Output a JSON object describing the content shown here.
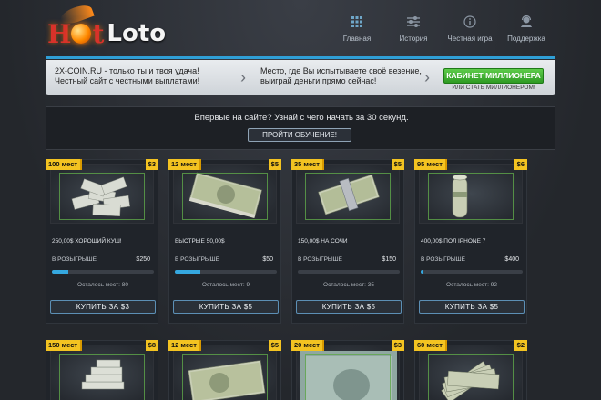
{
  "header": {
    "logo": {
      "part1": "H",
      "part2": "t",
      "part3": "Loto"
    },
    "nav": [
      {
        "label": "Главная",
        "icon": "grid-icon"
      },
      {
        "label": "История",
        "icon": "sliders-icon"
      },
      {
        "label": "Честная игра",
        "icon": "info-icon"
      },
      {
        "label": "Поддержка",
        "icon": "support-icon"
      }
    ]
  },
  "promo": {
    "left_line1": "2X-COIN.RU - только ты и твоя удача!",
    "left_line2": "Честный сайт с честными выплатами!",
    "mid_line1": "Место, где Вы испытываете своё везение,",
    "mid_line2": "выиграй деньги прямо сейчас!",
    "cabinet_button": "КАБИНЕТ МИЛЛИОНЕРА",
    "cabinet_sub": "ИЛИ СТАТЬ МИЛЛИОНЕРОМ!"
  },
  "onboarding": {
    "text": "Впервые на сайте? Узнай с чего начать за 30 секунд.",
    "button": "ПРОЙТИ ОБУЧЕНИЕ!"
  },
  "cards": [
    {
      "places": "100 мест",
      "price": "$3",
      "title": "250,00$ ХОРОШИЙ КУШ!",
      "draw_label": "В РОЗЫГРЫШЕ",
      "draw_value": "$250",
      "progress": 0.16,
      "left": "Осталось мест: 80",
      "buy": "КУПИТЬ ЗА $3"
    },
    {
      "places": "12 мест",
      "price": "$5",
      "title": "БЫСТРЫЕ 50,00$",
      "draw_label": "В РОЗЫГРЫШЕ",
      "draw_value": "$50",
      "progress": 0.25,
      "left": "Осталось мест: 9",
      "buy": "КУПИТЬ ЗА $5"
    },
    {
      "places": "35 мест",
      "price": "$5",
      "title": "150,00$ НА СОЧИ",
      "draw_label": "В РОЗЫГРЫШЕ",
      "draw_value": "$150",
      "progress": 0.0,
      "left": "Осталось мест: 35",
      "buy": "КУПИТЬ ЗА $5"
    },
    {
      "places": "95 мест",
      "price": "$6",
      "title": "400,00$ ПОЛ IPHONE 7",
      "draw_label": "В РОЗЫГРЫШЕ",
      "draw_value": "$400",
      "progress": 0.03,
      "left": "Осталось мест: 92",
      "buy": "КУПИТЬ ЗА $5"
    }
  ],
  "cards_row2": [
    {
      "places": "150 мест",
      "price": "$8"
    },
    {
      "places": "12 мест",
      "price": "$5"
    },
    {
      "places": "20 мест",
      "price": "$3"
    },
    {
      "places": "60 мест",
      "price": "$2"
    }
  ]
}
